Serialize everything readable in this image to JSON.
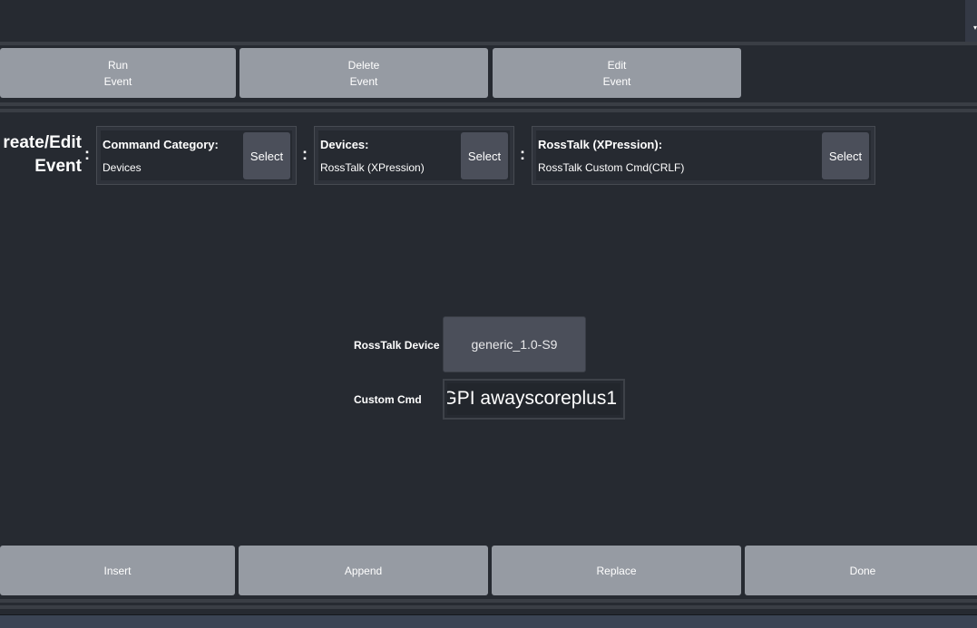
{
  "top_buttons": [
    {
      "line1": "Run",
      "line2": "Event"
    },
    {
      "line1": "Delete",
      "line2": "Event"
    },
    {
      "line1": "Edit",
      "line2": "Event"
    }
  ],
  "title": {
    "line1": "reate/Edit",
    "line2": "Event"
  },
  "colon": ":",
  "selectors": [
    {
      "heading": "Command Category:",
      "value": "Devices",
      "button": "Select"
    },
    {
      "heading": "Devices:",
      "value": "RossTalk (XPression)",
      "button": "Select"
    },
    {
      "heading": "RossTalk (XPression):",
      "value": "RossTalk Custom Cmd(CRLF)",
      "button": "Select"
    }
  ],
  "form": {
    "device_label": "RossTalk Device",
    "device_value": "generic_1.0-S9",
    "cmd_label": "Custom Cmd",
    "cmd_value": "GPI awayscoreplus1"
  },
  "bottom_buttons": [
    "Insert",
    "Append",
    "Replace",
    "Done"
  ]
}
